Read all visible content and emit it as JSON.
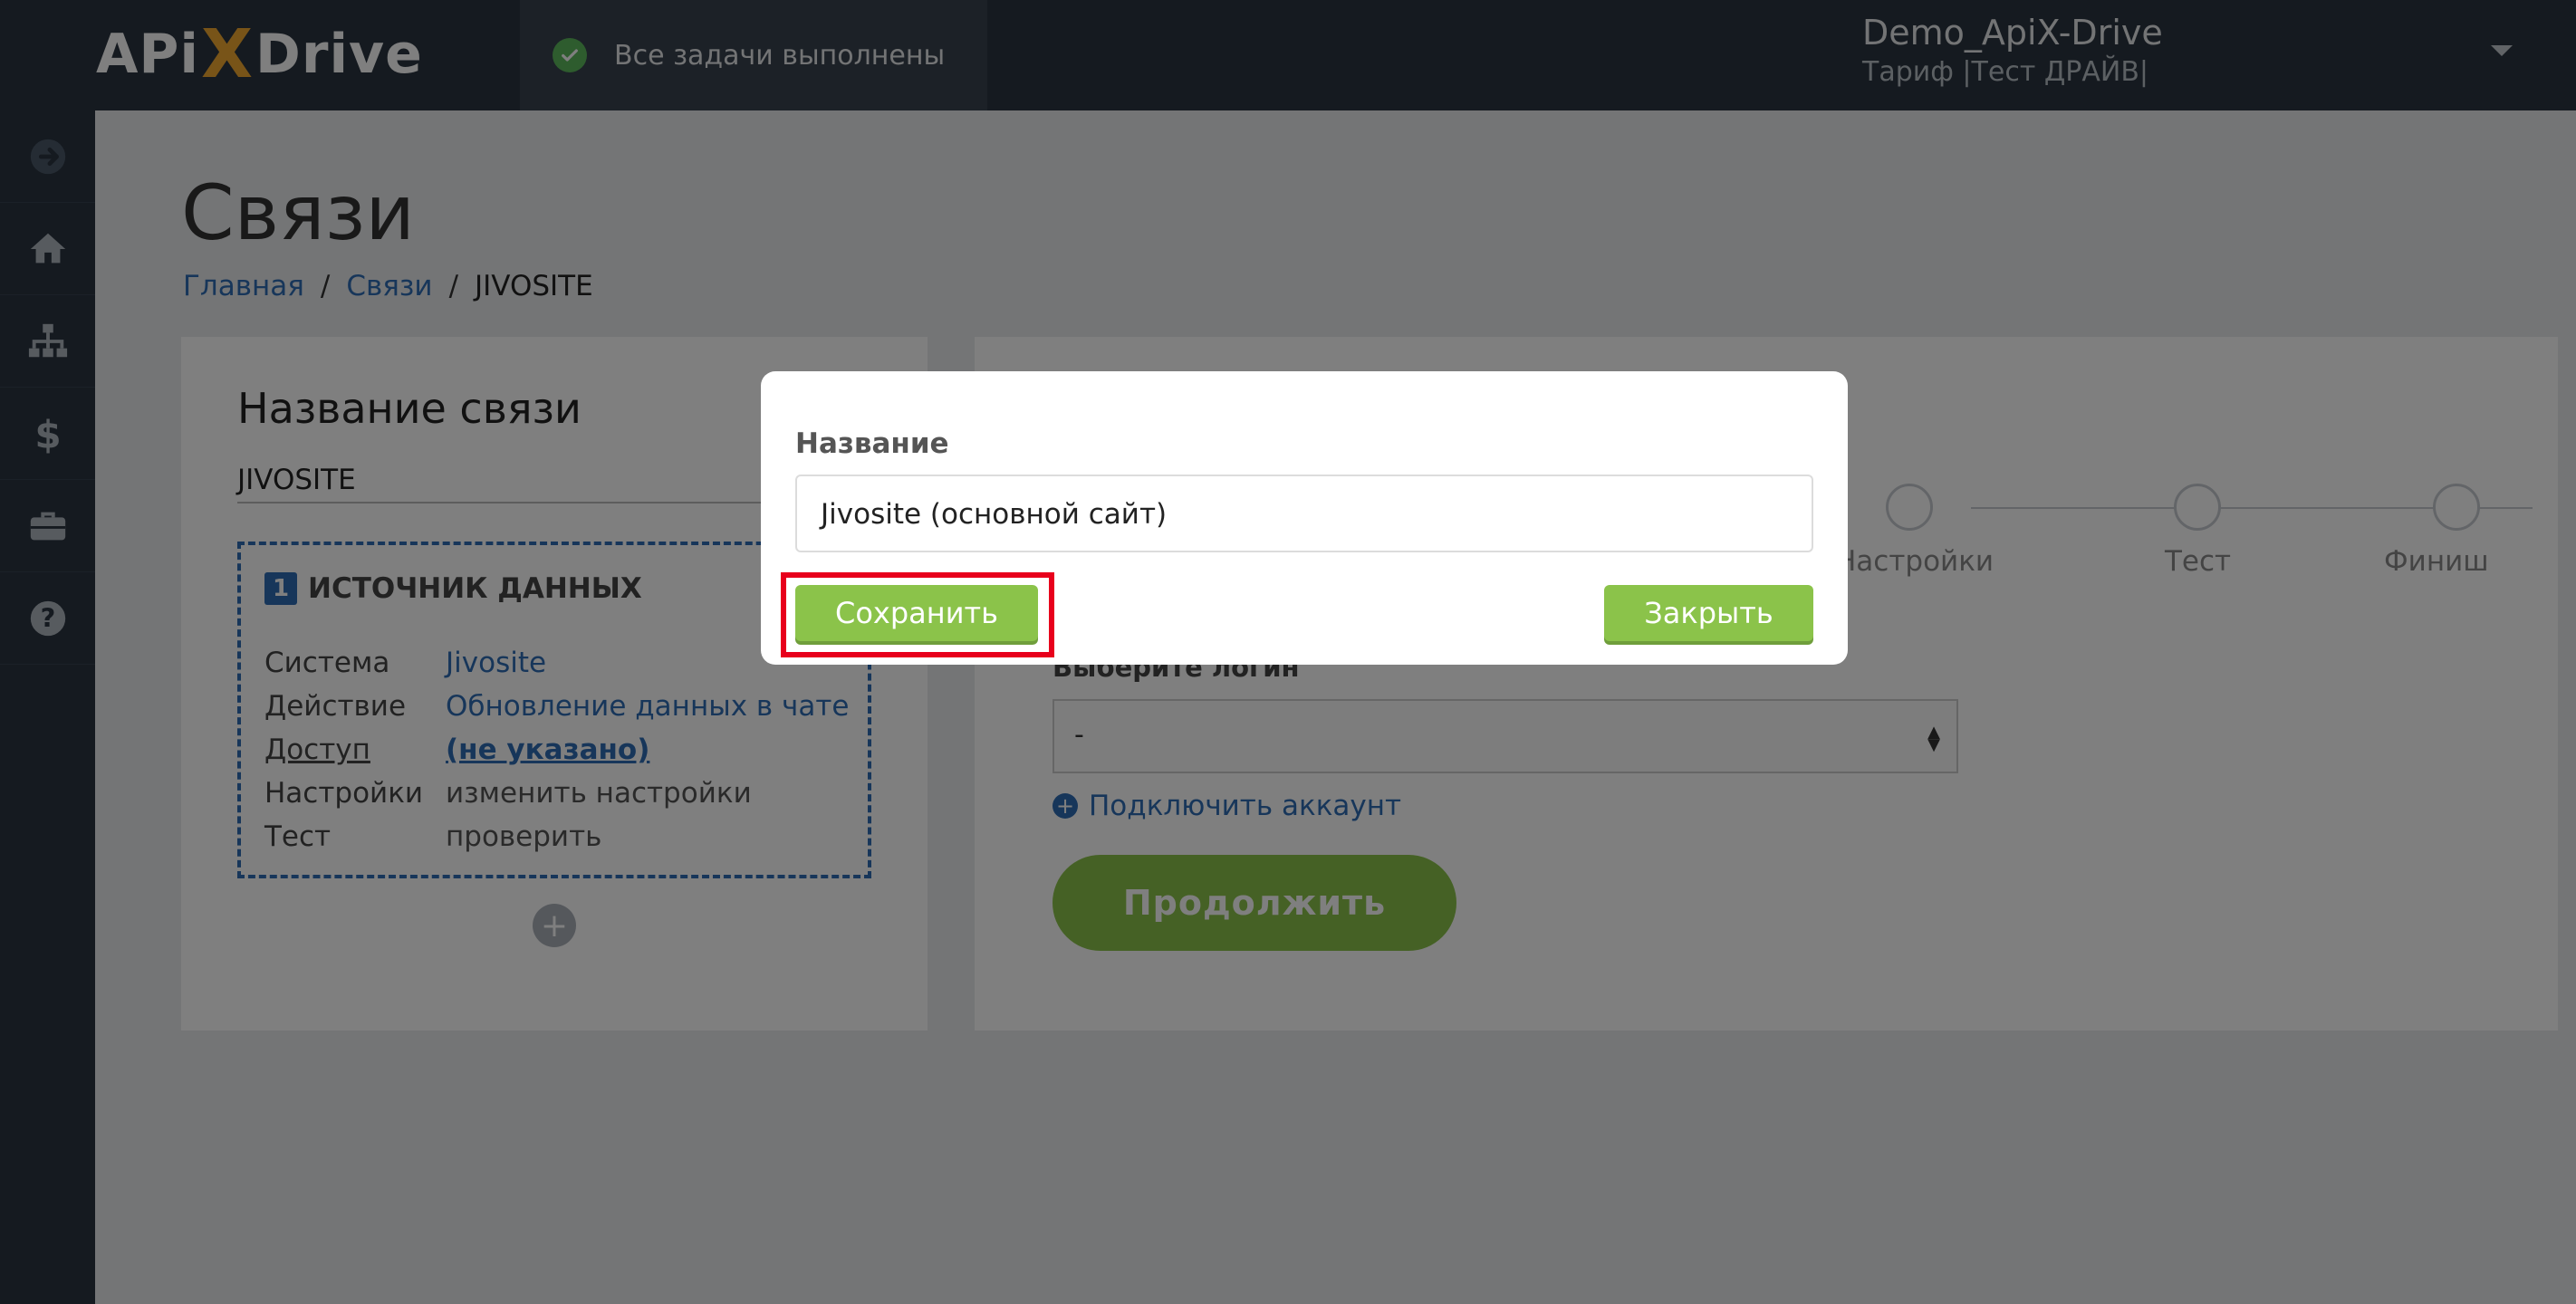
{
  "topbar": {
    "logo_left": "APi",
    "logo_x": "X",
    "logo_right": "Drive",
    "status_text": "Все задачи выполнены",
    "user_name": "Demo_ApiX-Drive",
    "user_plan": "Тариф |Тест ДРАЙВ|"
  },
  "sidebar": {
    "items": [
      "arrow-circle-icon",
      "home-icon",
      "sitemap-icon",
      "dollar-icon",
      "briefcase-icon",
      "help-icon"
    ]
  },
  "page": {
    "title": "Связи",
    "breadcrumb": {
      "home": "Главная",
      "sep1": "/",
      "links": "Связи",
      "sep2": "/",
      "current": "JIVOSITE"
    }
  },
  "left_card": {
    "title": "Название связи",
    "name_value": "JIVOSITE",
    "source": {
      "number": "1",
      "title": "ИСТОЧНИК ДАННЫХ",
      "rows": [
        {
          "key": "Система",
          "value": "Jivosite"
        },
        {
          "key": "Действие",
          "value": "Обновление данных в чате"
        },
        {
          "key": "Доступ",
          "value": "(не указано)"
        },
        {
          "key": "Настройки",
          "value": "изменить настройки"
        },
        {
          "key": "Тест",
          "value": "проверить"
        }
      ]
    },
    "add_symbol": "+"
  },
  "right_card": {
    "steps": [
      "Настройки",
      "Тест",
      "Финиш"
    ],
    "field_label": "Выберите логин",
    "select_value": "-",
    "connect_label": "Подключить аккаунт",
    "continue_label": "Продолжить"
  },
  "modal": {
    "label": "Название",
    "input_value": "Jivosite (основной сайт)",
    "save_label": "Сохранить",
    "close_label": "Закрыть"
  },
  "colors": {
    "accent_green": "#8bc34a",
    "link_blue": "#2f6db5",
    "highlight_red": "#e8001c",
    "dark_bar": "#2b3541"
  }
}
